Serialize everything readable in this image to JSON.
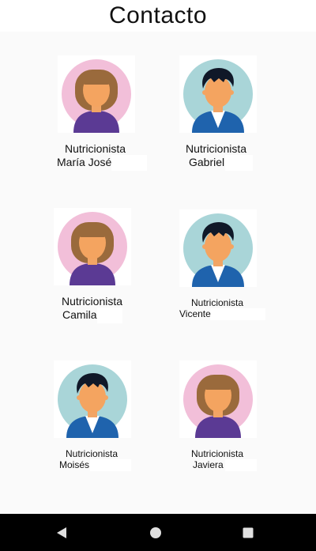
{
  "header": {
    "title": "Contacto"
  },
  "contacts": [
    {
      "role": "Nutricionista",
      "name": "María José",
      "avatar": "female-avatar-icon",
      "bg": "#f2bfd9"
    },
    {
      "role": "Nutricionista",
      "name": "Gabriel",
      "avatar": "male-avatar-icon",
      "bg": "#a9d5d8"
    },
    {
      "role": "Nutricionista",
      "name": "Camila",
      "avatar": "female-avatar-icon",
      "bg": "#f2bfd9"
    },
    {
      "role": "Nutricionista",
      "name": "Vicente",
      "avatar": "male-avatar-icon",
      "bg": "#a9d5d8"
    },
    {
      "role": "Nutricionista",
      "name": "Moisés",
      "avatar": "male-avatar-icon",
      "bg": "#a9d5d8"
    },
    {
      "role": "Nutricionista",
      "name": "Javiera",
      "avatar": "female-avatar-icon",
      "bg": "#f2bfd9"
    }
  ],
  "navigation": {
    "back": "back-triangle-icon",
    "home": "home-circle-icon",
    "recents": "recents-square-icon"
  },
  "colors": {
    "hair_female": "#9a6a3c",
    "hair_male": "#101828",
    "skin": "#f4a460",
    "shirt_female": "#5b3a94",
    "jacket_male": "#1f63ad"
  }
}
